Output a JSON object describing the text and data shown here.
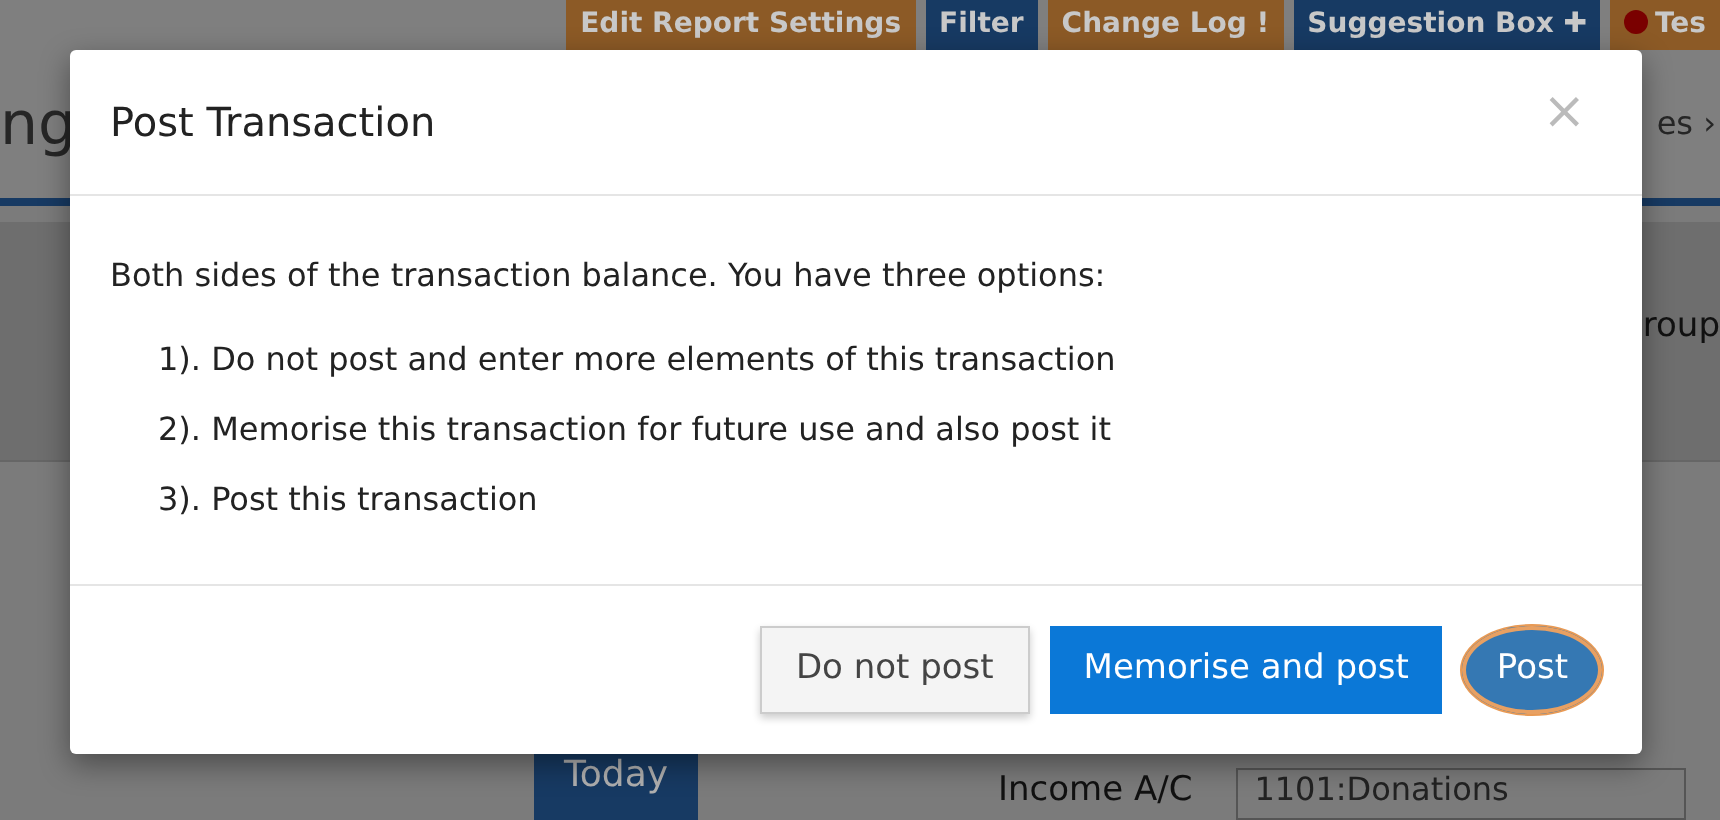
{
  "background": {
    "toolbar": [
      {
        "label": "Edit Report Settings",
        "color": "#8c5a26",
        "kind": "plain"
      },
      {
        "label": "Filter",
        "color": "#173a63",
        "kind": "plain"
      },
      {
        "label": "Change Log",
        "color": "#8c5a26",
        "kind": "suffix",
        "suffix": "!"
      },
      {
        "label": "Suggestion Box",
        "color": "#173a63",
        "kind": "suffix",
        "suffix": "✚"
      },
      {
        "label": "Tes",
        "color": "#8c5a26",
        "kind": "record"
      }
    ],
    "heading_fragment": "ng",
    "breadcrumb_fragment": "es ›",
    "group_fragment": "roup",
    "today_button": "Today",
    "income_label": "Income A/C",
    "income_value": "1101:Donations"
  },
  "dialog": {
    "title": "Post Transaction",
    "close": "×",
    "message": "Both sides of the transaction balance. You have three options:",
    "options": [
      "1). Do not post and enter more elements of this transaction",
      "2). Memorise this transaction for future use and also post it",
      "3). Post this transaction"
    ],
    "buttons": [
      {
        "label": "Do not post",
        "kind": "secondary",
        "focused": false
      },
      {
        "label": "Memorise and post",
        "kind": "primary",
        "focused": false
      },
      {
        "label": "Post",
        "kind": "primary",
        "focused": true
      }
    ]
  }
}
